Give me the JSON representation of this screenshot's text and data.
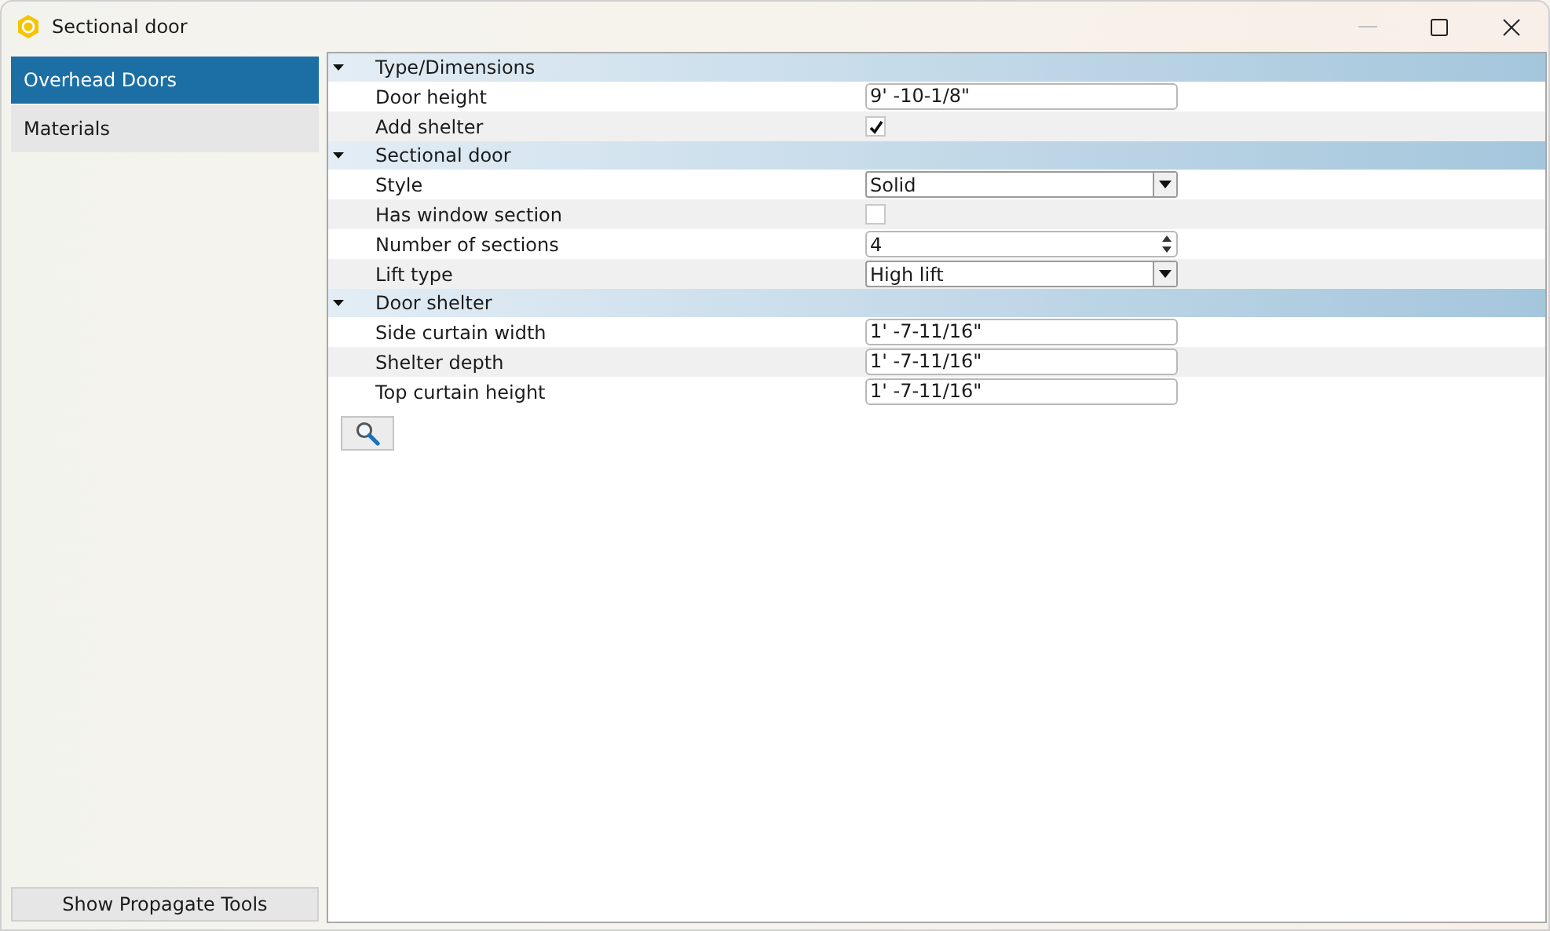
{
  "window": {
    "title": "Sectional door"
  },
  "sidebar": {
    "items": [
      {
        "label": "Overhead Doors",
        "selected": true
      },
      {
        "label": "Materials",
        "selected": false
      }
    ],
    "footer_button": "Show Propagate Tools"
  },
  "sections": [
    {
      "title": "Type/Dimensions",
      "expanded": true,
      "rows": [
        {
          "label": "Door height",
          "kind": "text",
          "value": "9' -10-1/8\""
        },
        {
          "label": "Add shelter",
          "kind": "checkbox",
          "checked": true
        }
      ]
    },
    {
      "title": "Sectional door",
      "expanded": true,
      "rows": [
        {
          "label": "Style",
          "kind": "dropdown",
          "value": "Solid"
        },
        {
          "label": "Has window section",
          "kind": "checkbox",
          "checked": false
        },
        {
          "label": "Number of sections",
          "kind": "spinner",
          "value": "4"
        },
        {
          "label": "Lift type",
          "kind": "dropdown",
          "value": "High lift"
        }
      ]
    },
    {
      "title": "Door shelter",
      "expanded": true,
      "rows": [
        {
          "label": "Side curtain width",
          "kind": "text",
          "value": "1' -7-11/16\""
        },
        {
          "label": "Shelter depth",
          "kind": "text",
          "value": "1' -7-11/16\""
        },
        {
          "label": "Top curtain height",
          "kind": "text",
          "value": "1' -7-11/16\""
        }
      ]
    }
  ]
}
